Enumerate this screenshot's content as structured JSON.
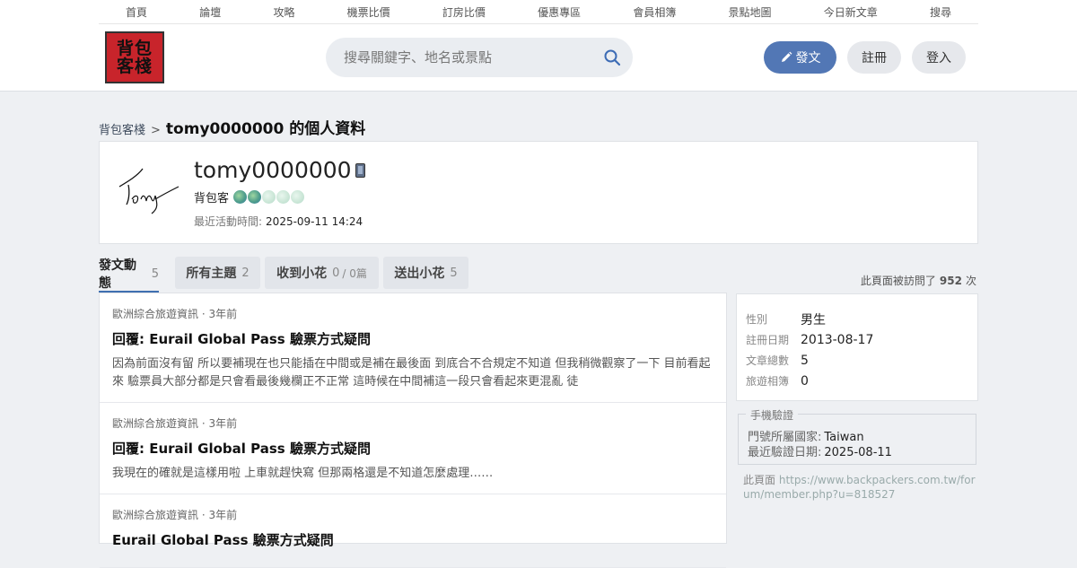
{
  "topnav": [
    "首頁",
    "論壇",
    "攻略",
    "機票比價",
    "訂房比價",
    "優惠專區",
    "會員相簿",
    "景點地圖",
    "今日新文章",
    "搜尋"
  ],
  "logo": {
    "line1": "背包",
    "line2": "客棧"
  },
  "search": {
    "placeholder": "搜尋關鍵字、地名或景點"
  },
  "buttons": {
    "post": "發文",
    "register": "註冊",
    "login": "登入"
  },
  "breadcrumb": {
    "home": "背包客棧",
    "separator": ">",
    "title": "tomy0000000 的個人資料"
  },
  "profile": {
    "username": "tomy0000000",
    "rank": "背包客",
    "globes_filled": 2,
    "globes_total": 5,
    "last_active_label": "最近活動時間:",
    "last_active_value": "2025-09-11 14:24"
  },
  "tabs": [
    {
      "label": "發文動態",
      "count": "5"
    },
    {
      "label": "所有主題",
      "count": "2"
    },
    {
      "label": "收到小花",
      "count": "0",
      "extra": "/ 0篇"
    },
    {
      "label": "送出小花",
      "count": "5"
    }
  ],
  "visits": {
    "prefix": "此頁面被訪問了",
    "count": "952",
    "suffix": "次"
  },
  "posts": [
    {
      "meta": "歐洲綜合旅遊資訊 · 3年前",
      "title": "回覆: Eurail Global Pass 驗票方式疑問",
      "body": "因為前面沒有留 所以要補現在也只能插在中間或是補在最後面 到底合不合規定不知道 但我稍微觀察了一下 目前看起來 驗票員大部分都是只會看最後幾欄正不正常 這時候在中間補這一段只會看起來更混亂 徒"
    },
    {
      "meta": "歐洲綜合旅遊資訊 · 3年前",
      "title": "回覆: Eurail Global Pass 驗票方式疑問",
      "body": "我現在的確就是這樣用啦 上車就趕快寫 但那兩格還是不知道怎麼處理……"
    },
    {
      "meta": "歐洲綜合旅遊資訊 · 3年前",
      "title": "Eurail Global Pass 驗票方式疑問",
      "body": ""
    }
  ],
  "info": [
    {
      "key": "性別",
      "value": "男生"
    },
    {
      "key": "註冊日期",
      "value": "2013-08-17"
    },
    {
      "key": "文章總數",
      "value": "5"
    },
    {
      "key": "旅遊相簿",
      "value": "0"
    }
  ],
  "phone_verify": {
    "legend": "手機驗證",
    "country_label": "門號所屬國家:",
    "country_value": "Taiwan",
    "date_label": "最近驗證日期:",
    "date_value": "2025-08-11"
  },
  "page_url": {
    "label": "此頁面",
    "url": "https://www.backpackers.com.tw/forum/member.php?u=818527"
  }
}
